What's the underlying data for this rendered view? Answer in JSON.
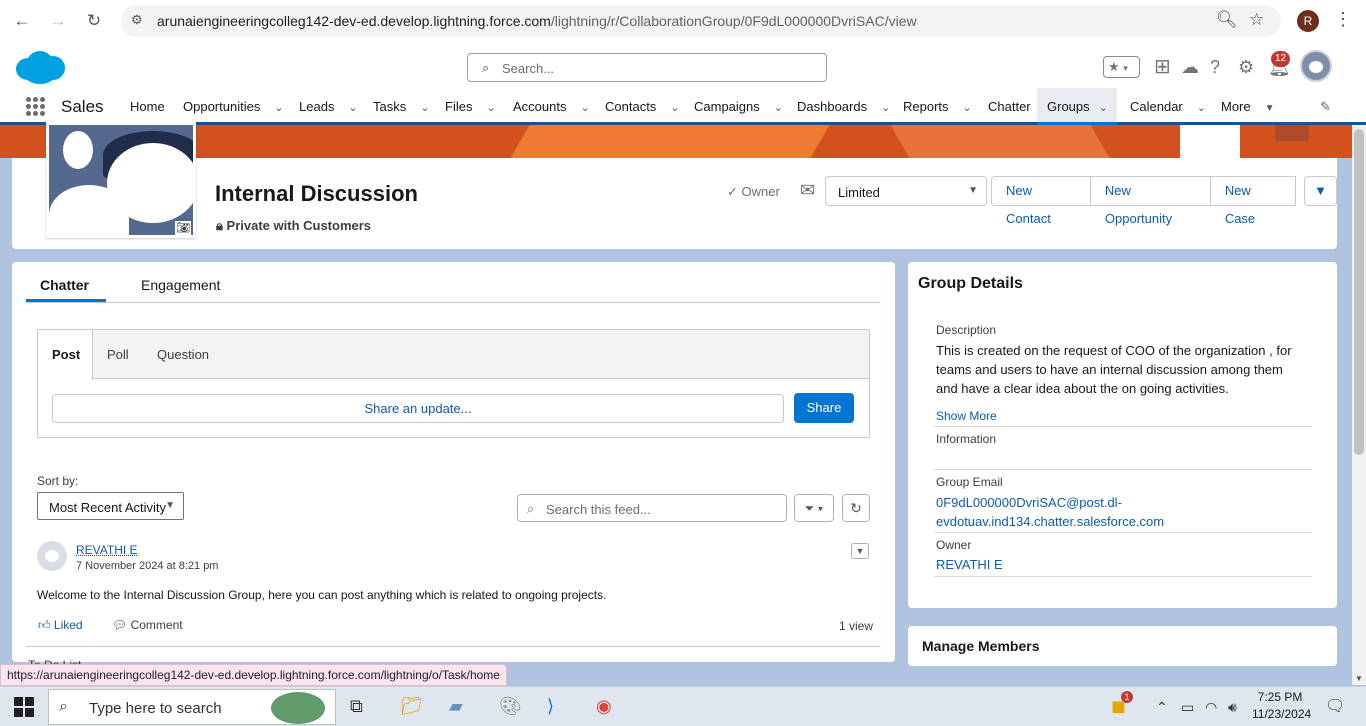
{
  "browser": {
    "url_main": "arunaiengineeringcolleg142-dev-ed.develop.lightning.force.com",
    "url_path": "/lightning/r/CollaborationGroup/0F9dL000000DvriSAC/view",
    "profile_initial": "R"
  },
  "header": {
    "search_placeholder": "Search...",
    "notification_count": "12"
  },
  "nav": {
    "app_name": "Sales",
    "items": [
      "Home",
      "Opportunities",
      "Leads",
      "Tasks",
      "Files",
      "Accounts",
      "Contacts",
      "Campaigns",
      "Dashboards",
      "Reports",
      "Chatter",
      "Groups",
      "Calendar",
      "More"
    ],
    "active": "Groups"
  },
  "group": {
    "title": "Internal Discussion",
    "privacy": "Private with Customers",
    "owner_label": "Owner",
    "notify_value": "Limited",
    "actions": [
      "New Contact",
      "New Opportunity",
      "New Case"
    ]
  },
  "feed": {
    "tabs": [
      "Chatter",
      "Engagement"
    ],
    "publisher_tabs": [
      "Post",
      "Poll",
      "Question"
    ],
    "share_placeholder": "Share an update...",
    "share_button": "Share",
    "sort_label": "Sort by:",
    "sort_value": "Most Recent Activity",
    "search_placeholder": "Search this feed...",
    "post": {
      "author": "REVATHI E",
      "date": "7 November 2024 at 8:21 pm",
      "body": "Welcome to the Internal Discussion Group, here you can post anything which is related to ongoing projects.",
      "liked": "Liked",
      "comment": "Comment",
      "views": "1 view"
    }
  },
  "details": {
    "title": "Group Details",
    "description_label": "Description",
    "description": "This is created on the request of COO of the organization , for teams and users to have an internal discussion among them and have a clear idea about the on going activities.",
    "show_more": "Show More",
    "information_label": "Information",
    "email_label": "Group Email",
    "email_line1": "0F9dL000000DvriSAC@post.dl-",
    "email_line2": "evdotuav.ind134.chatter.salesforce.com",
    "owner_label": "Owner",
    "owner_value": "REVATHI E"
  },
  "manage_members": "Manage Members",
  "status_url": "https://arunaiengineeringcolleg142-dev-ed.develop.lightning.force.com/lightning/o/Task/home",
  "todo_partial": "To Do List",
  "taskbar": {
    "search_placeholder": "Type here to search",
    "time": "7:25 PM",
    "date": "11/23/2024",
    "badge": "1"
  }
}
